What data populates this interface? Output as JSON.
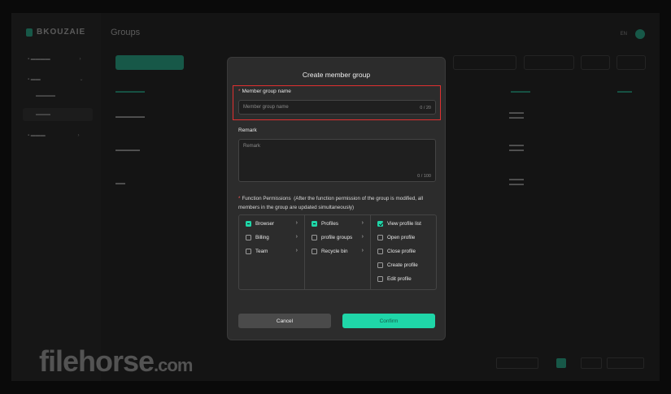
{
  "background": {
    "logo": "BKOUZAIE",
    "page_title": "Groups",
    "top_right": {
      "lang": "EN"
    },
    "watermark": {
      "main": "filehorse",
      "suffix": ".com"
    }
  },
  "modal": {
    "title": "Create member group",
    "group_name": {
      "label": "Member group name",
      "required_mark": "*",
      "placeholder": "Member group name",
      "counter": "0 / 20",
      "value": ""
    },
    "remark": {
      "label": "Remark",
      "placeholder": "Remark",
      "counter": "0 / 100",
      "value": ""
    },
    "permissions": {
      "label": "Function Permissions",
      "required_mark": "*",
      "hint": "(After the function permission of the group is modified, all members in the group are updated simultaneously)",
      "col1": [
        {
          "label": "Browser",
          "state": "partial"
        },
        {
          "label": "Billing",
          "state": "unchecked"
        },
        {
          "label": "Team",
          "state": "unchecked"
        }
      ],
      "col2": [
        {
          "label": "Profiles",
          "state": "partial"
        },
        {
          "label": "profile groups",
          "state": "unchecked"
        },
        {
          "label": "Recycle bin",
          "state": "unchecked"
        }
      ],
      "col3": [
        {
          "label": "View profile list",
          "state": "checked"
        },
        {
          "label": "Open profile",
          "state": "unchecked"
        },
        {
          "label": "Close profile",
          "state": "unchecked"
        },
        {
          "label": "Create profile",
          "state": "unchecked"
        },
        {
          "label": "Edit profile",
          "state": "unchecked"
        }
      ],
      "chevron": "›"
    },
    "cancel_label": "Cancel",
    "confirm_label": "Confirm"
  },
  "colors": {
    "accent": "#1fd6a8",
    "highlight": "#e03030",
    "required": "#ff5a5a"
  }
}
